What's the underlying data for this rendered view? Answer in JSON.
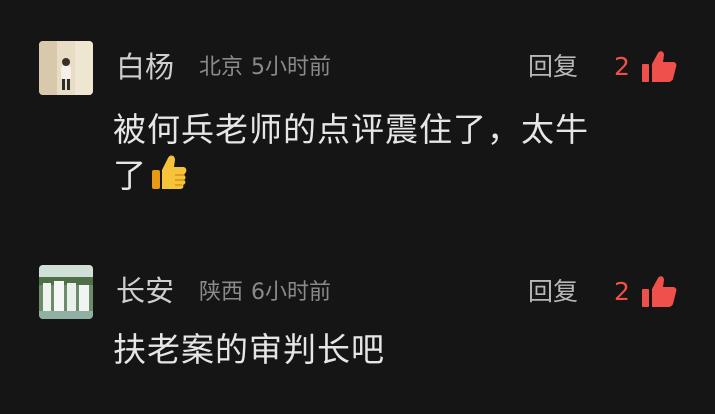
{
  "comments": [
    {
      "user": "白杨",
      "location": "北京",
      "time": "5小时前",
      "reply_label": "回复",
      "like_count": "2",
      "text_line1": "被何兵老师的点评震住了，太牛",
      "text_line2": "了",
      "emoji": "thumbs-up-emoji",
      "avatar": "person-photo"
    },
    {
      "user": "长安",
      "location": "陕西",
      "time": "6小时前",
      "reply_label": "回复",
      "like_count": "2",
      "text_line1": "扶老案的审判长吧",
      "avatar": "waterfall-photo"
    }
  ],
  "colors": {
    "background": "#151515",
    "like_accent": "#f0504b",
    "name_text": "#cfcfcf",
    "meta_text": "#8a8a8a",
    "body_text": "#e6e6e6"
  }
}
